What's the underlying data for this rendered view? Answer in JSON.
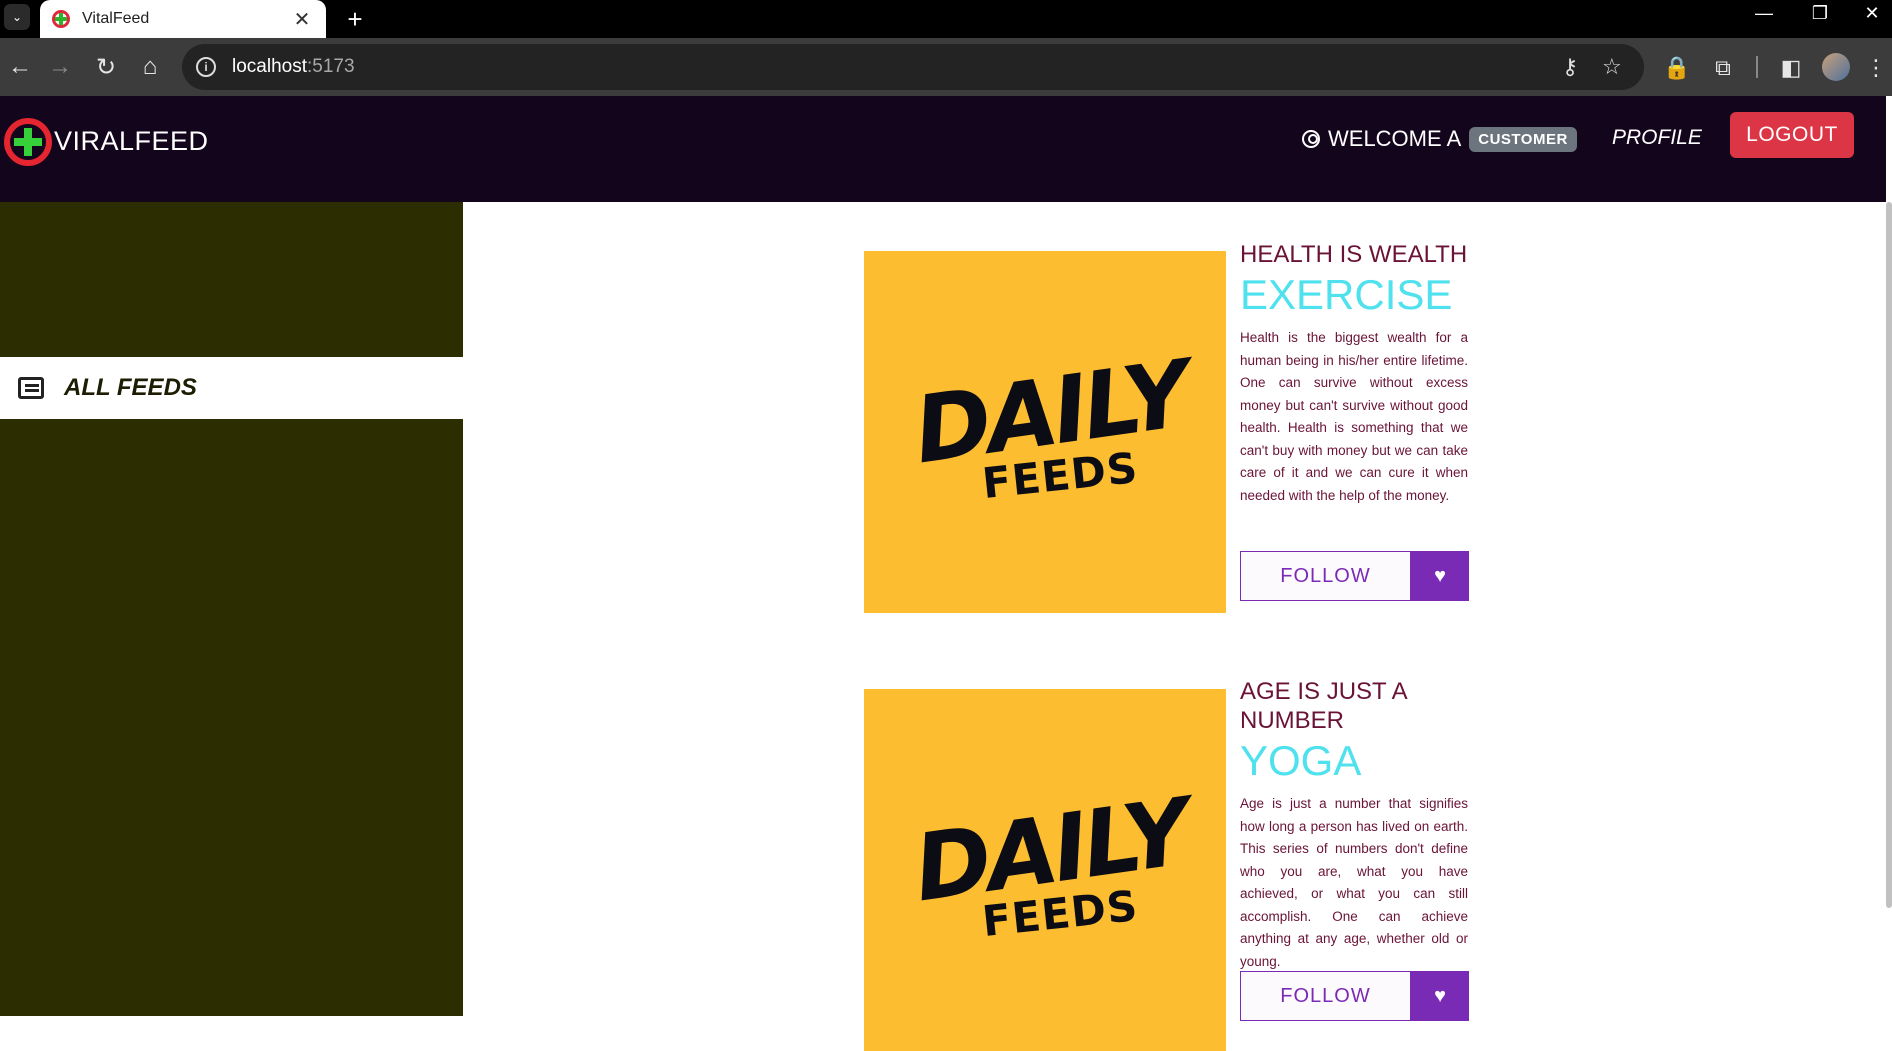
{
  "browser": {
    "tab_title": "VitalFeed",
    "tab_close": "✕",
    "new_tab": "+",
    "url_host": "localhost",
    "url_port": ":5173"
  },
  "header": {
    "brand": "VIRALFEED",
    "welcome_text": "WELCOME A",
    "role_badge": "CUSTOMER",
    "profile_label": "PROFILE",
    "logout_label": "LOGOUT"
  },
  "sidebar": {
    "items": [
      {
        "label": "ALL FEEDS",
        "icon": "newspaper-icon"
      }
    ]
  },
  "feeds": [
    {
      "image_text_main": "DAILY",
      "image_text_sub": "FEEDS",
      "heading": "HEALTH IS WEALTH",
      "title": "EXERCISE",
      "description": "Health is the biggest wealth for a human being in his/her entire lifetime. One can survive without excess money but can't survive without good health. Health is something that we can't buy with money but we can take care of it and we can cure it when needed with the help of the money.",
      "follow_label": "FOLLOW",
      "heart": "♥"
    },
    {
      "image_text_main": "DAILY",
      "image_text_sub": "FEEDS",
      "heading": "AGE IS JUST A NUMBER",
      "title": "YOGA",
      "description": "Age is just a number that signifies how long a person has lived on earth. This series of numbers don't define who you are, what you have achieved, or what you can still accomplish. One can achieve anything at any age, whether old or young.",
      "follow_label": "FOLLOW",
      "heart": "♥"
    }
  ],
  "colors": {
    "header_bg": "#13051c",
    "sidebar_bg": "#2c2e02",
    "logout": "#dc3545",
    "follow_accent": "#7a2bb5",
    "title_cyan": "#4fe1ee",
    "heading_maroon": "#6a1336",
    "image_bg": "#fdbd31"
  }
}
